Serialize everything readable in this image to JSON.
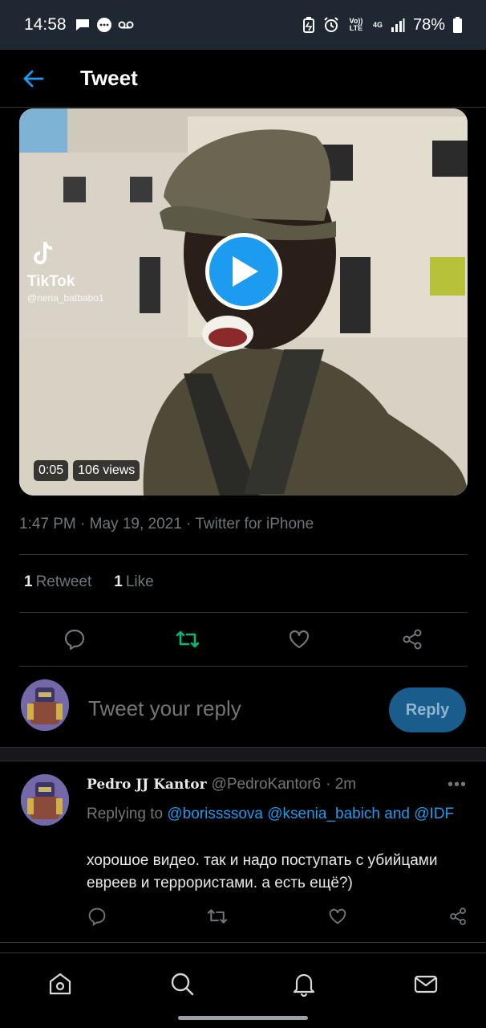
{
  "status_bar": {
    "time": "14:58",
    "network_top": "Vo)) LTE",
    "net4g": "4G",
    "battery": "78%"
  },
  "header": {
    "title": "Tweet"
  },
  "media": {
    "duration": "0:05",
    "views": "106 views",
    "watermark_brand": "TikTok",
    "watermark_user": "@neria_batbabo1"
  },
  "tweet": {
    "timestamp": "1:47 PM · May 19, 2021 · Twitter for iPhone",
    "retweet_count": "1",
    "retweet_label": "Retweet",
    "like_count": "1",
    "like_label": "Like"
  },
  "composer": {
    "placeholder": "Tweet your reply",
    "button": "Reply"
  },
  "reply": {
    "display_name": "Pedro JJ Kantor",
    "handle": "@PedroKantor6",
    "time": "· 2m",
    "more": "•••",
    "replying_prefix": "Replying to",
    "mention1": "@borissssova",
    "mention2": "@ksenia_babich",
    "and": "and",
    "mention3": "@IDF",
    "text": "хорошое видео. так и надо поступать с убийцами евреев и террористами. а есть ещё?)"
  },
  "colors": {
    "accent": "#1d9bf0",
    "retweet_active": "#00ba7c",
    "muted": "#71767b",
    "status_bar_bg": "#1f2733"
  }
}
